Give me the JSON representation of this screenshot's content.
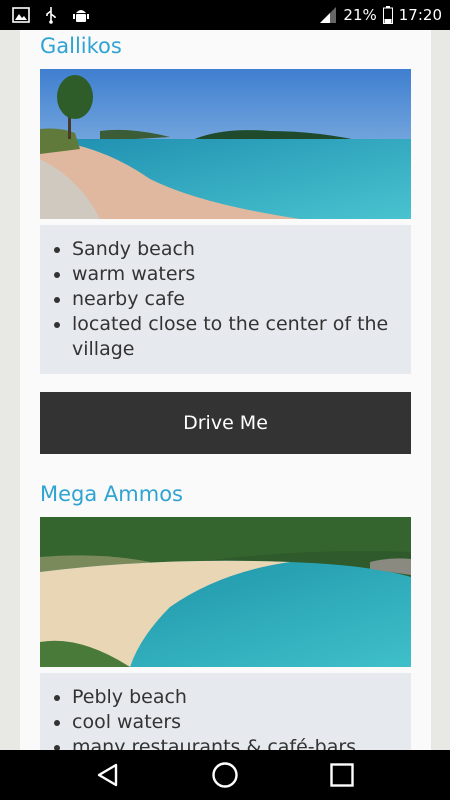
{
  "status_bar": {
    "battery_percent": "21%",
    "time": "17:20",
    "icons": [
      "gallery-icon",
      "usb-icon",
      "android-debug-icon",
      "signal-icon",
      "battery-icon"
    ]
  },
  "beaches": [
    {
      "name": "Gallikos",
      "image": "beach-photo-gallikos",
      "features": [
        "Sandy beach",
        "warm waters",
        "nearby cafe",
        "located close to the center of the village"
      ],
      "button_label": "Drive Me"
    },
    {
      "name": "Mega Ammos",
      "image": "beach-photo-mega-ammos",
      "features": [
        "Pebly beach",
        "cool waters",
        "many restaurants & café-bars"
      ]
    }
  ],
  "nav_bar": {
    "icons": [
      "back-icon",
      "home-icon",
      "recents-icon"
    ]
  },
  "colors": {
    "title": "#2fa3d3",
    "button": "#333333",
    "list_bg": "#e6e9ee"
  }
}
